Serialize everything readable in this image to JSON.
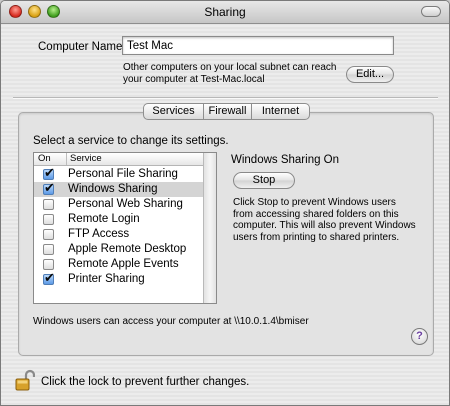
{
  "window": {
    "title": "Sharing"
  },
  "computer": {
    "name_label": "Computer Name:",
    "name_value": "Test Mac",
    "subnet_note": "Other computers on your local subnet can reach your computer at Test-Mac.local",
    "edit_label": "Edit..."
  },
  "tabs": [
    {
      "label": "Services",
      "active": true
    },
    {
      "label": "Firewall",
      "active": false
    },
    {
      "label": "Internet",
      "active": false
    }
  ],
  "services_pane": {
    "instruction": "Select a service to change its settings.",
    "col_on": "On",
    "col_service": "Service",
    "services": [
      {
        "name": "Personal File Sharing",
        "on": true
      },
      {
        "name": "Windows Sharing",
        "on": true,
        "selected": true
      },
      {
        "name": "Personal Web Sharing",
        "on": false
      },
      {
        "name": "Remote Login",
        "on": false
      },
      {
        "name": "FTP Access",
        "on": false
      },
      {
        "name": "Apple Remote Desktop",
        "on": false
      },
      {
        "name": "Remote Apple Events",
        "on": false
      },
      {
        "name": "Printer Sharing",
        "on": true
      }
    ],
    "status_title": "Windows Sharing On",
    "stop_label": "Stop",
    "stop_description": "Click Stop to prevent Windows users from accessing shared folders on this computer. This will also prevent Windows users from printing to shared printers.",
    "access_note": "Windows users can access your computer at \\\\10.0.1.4\\bmiser",
    "help_label": "?"
  },
  "lock": {
    "note": "Click the lock to prevent further changes.",
    "icon": "lock-open-icon"
  },
  "colors": {
    "accent": "#5a97e2",
    "help_glyph": "#6b3fa0"
  }
}
